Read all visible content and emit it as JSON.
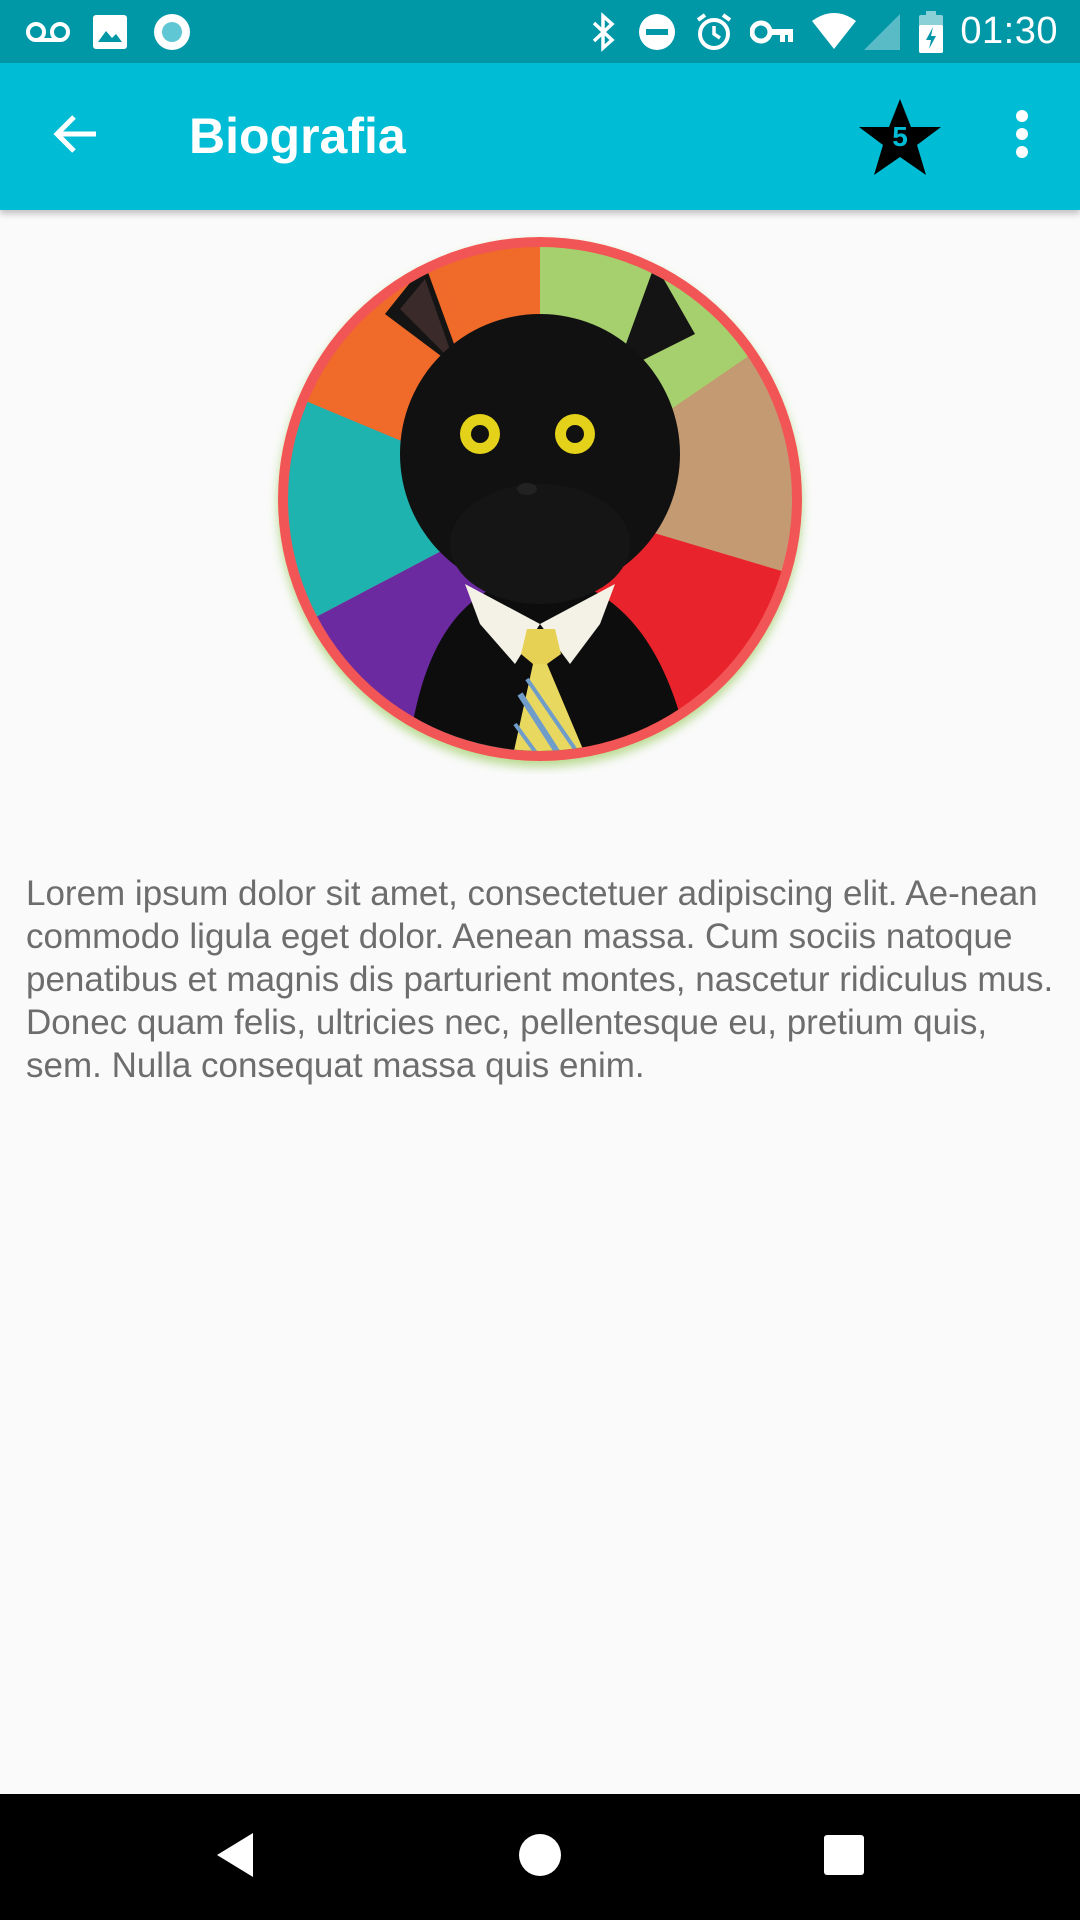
{
  "status_bar": {
    "time": "01:30",
    "left_icons": [
      "voicemail-icon",
      "image-icon",
      "sync-icon"
    ],
    "right_icons": [
      "bluetooth-icon",
      "do-not-disturb-icon",
      "alarm-icon",
      "vpn-key-icon",
      "wifi-icon",
      "signal-icon",
      "battery-charging-icon"
    ]
  },
  "app_bar": {
    "title": "Biografia",
    "badge_count": "5",
    "background_color": "#00bcd4",
    "status_color": "#0097a7"
  },
  "profile": {
    "avatar_ring_color": "#f25454"
  },
  "bio": {
    "text": "Lorem ipsum dolor sit amet, consectetuer adipiscing elit. Ae-nean commodo ligula eget dolor. Aenean massa. Cum sociis natoque penatibus et magnis dis parturient montes, nascetur ridiculus mus. Donec quam felis, ultricies nec, pellentesque eu, pretium quis, sem. Nulla consequat massa quis enim."
  },
  "nav_bar": {
    "buttons": [
      "back-triangle-icon",
      "home-circle-icon",
      "recents-square-icon"
    ]
  }
}
